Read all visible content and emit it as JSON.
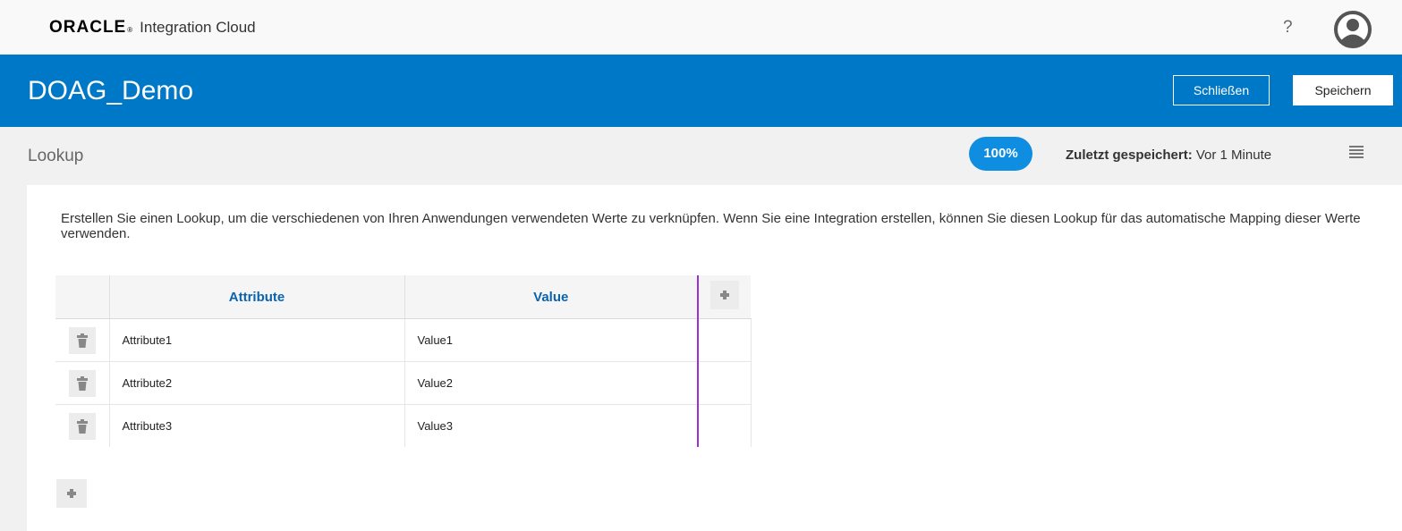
{
  "header": {
    "brand": "ORACLE",
    "brand_mark": "®",
    "product": "Integration Cloud",
    "help_label": "?",
    "icons": {
      "help": "question-mark-icon",
      "user": "user-avatar-icon"
    }
  },
  "banner": {
    "title": "DOAG_Demo",
    "close_label": "Schließen",
    "save_label": "Speichern",
    "color": "#0078c8"
  },
  "subheader": {
    "title": "Lookup",
    "progress": "100%",
    "saved_key": "Zuletzt gespeichert:",
    "saved_value": "Vor 1 Minute",
    "menu_icon": "hamburger-menu-icon"
  },
  "content": {
    "description": "Erstellen Sie einen Lookup, um die verschiedenen von Ihren Anwendungen verwendeten Werte zu verknüpfen. Wenn Sie eine Integration erstellen, können Sie diesen Lookup für das automatische Mapping dieser Werte verwenden.",
    "table": {
      "columns": [
        "Attribute",
        "Value"
      ],
      "rows": [
        {
          "attribute": "Attribute1",
          "value": "Value1"
        },
        {
          "attribute": "Attribute2",
          "value": "Value2"
        },
        {
          "attribute": "Attribute3",
          "value": "Value3"
        }
      ],
      "icons": {
        "delete": "trash-icon",
        "add_column": "plus-icon",
        "add_row": "plus-icon"
      }
    }
  }
}
